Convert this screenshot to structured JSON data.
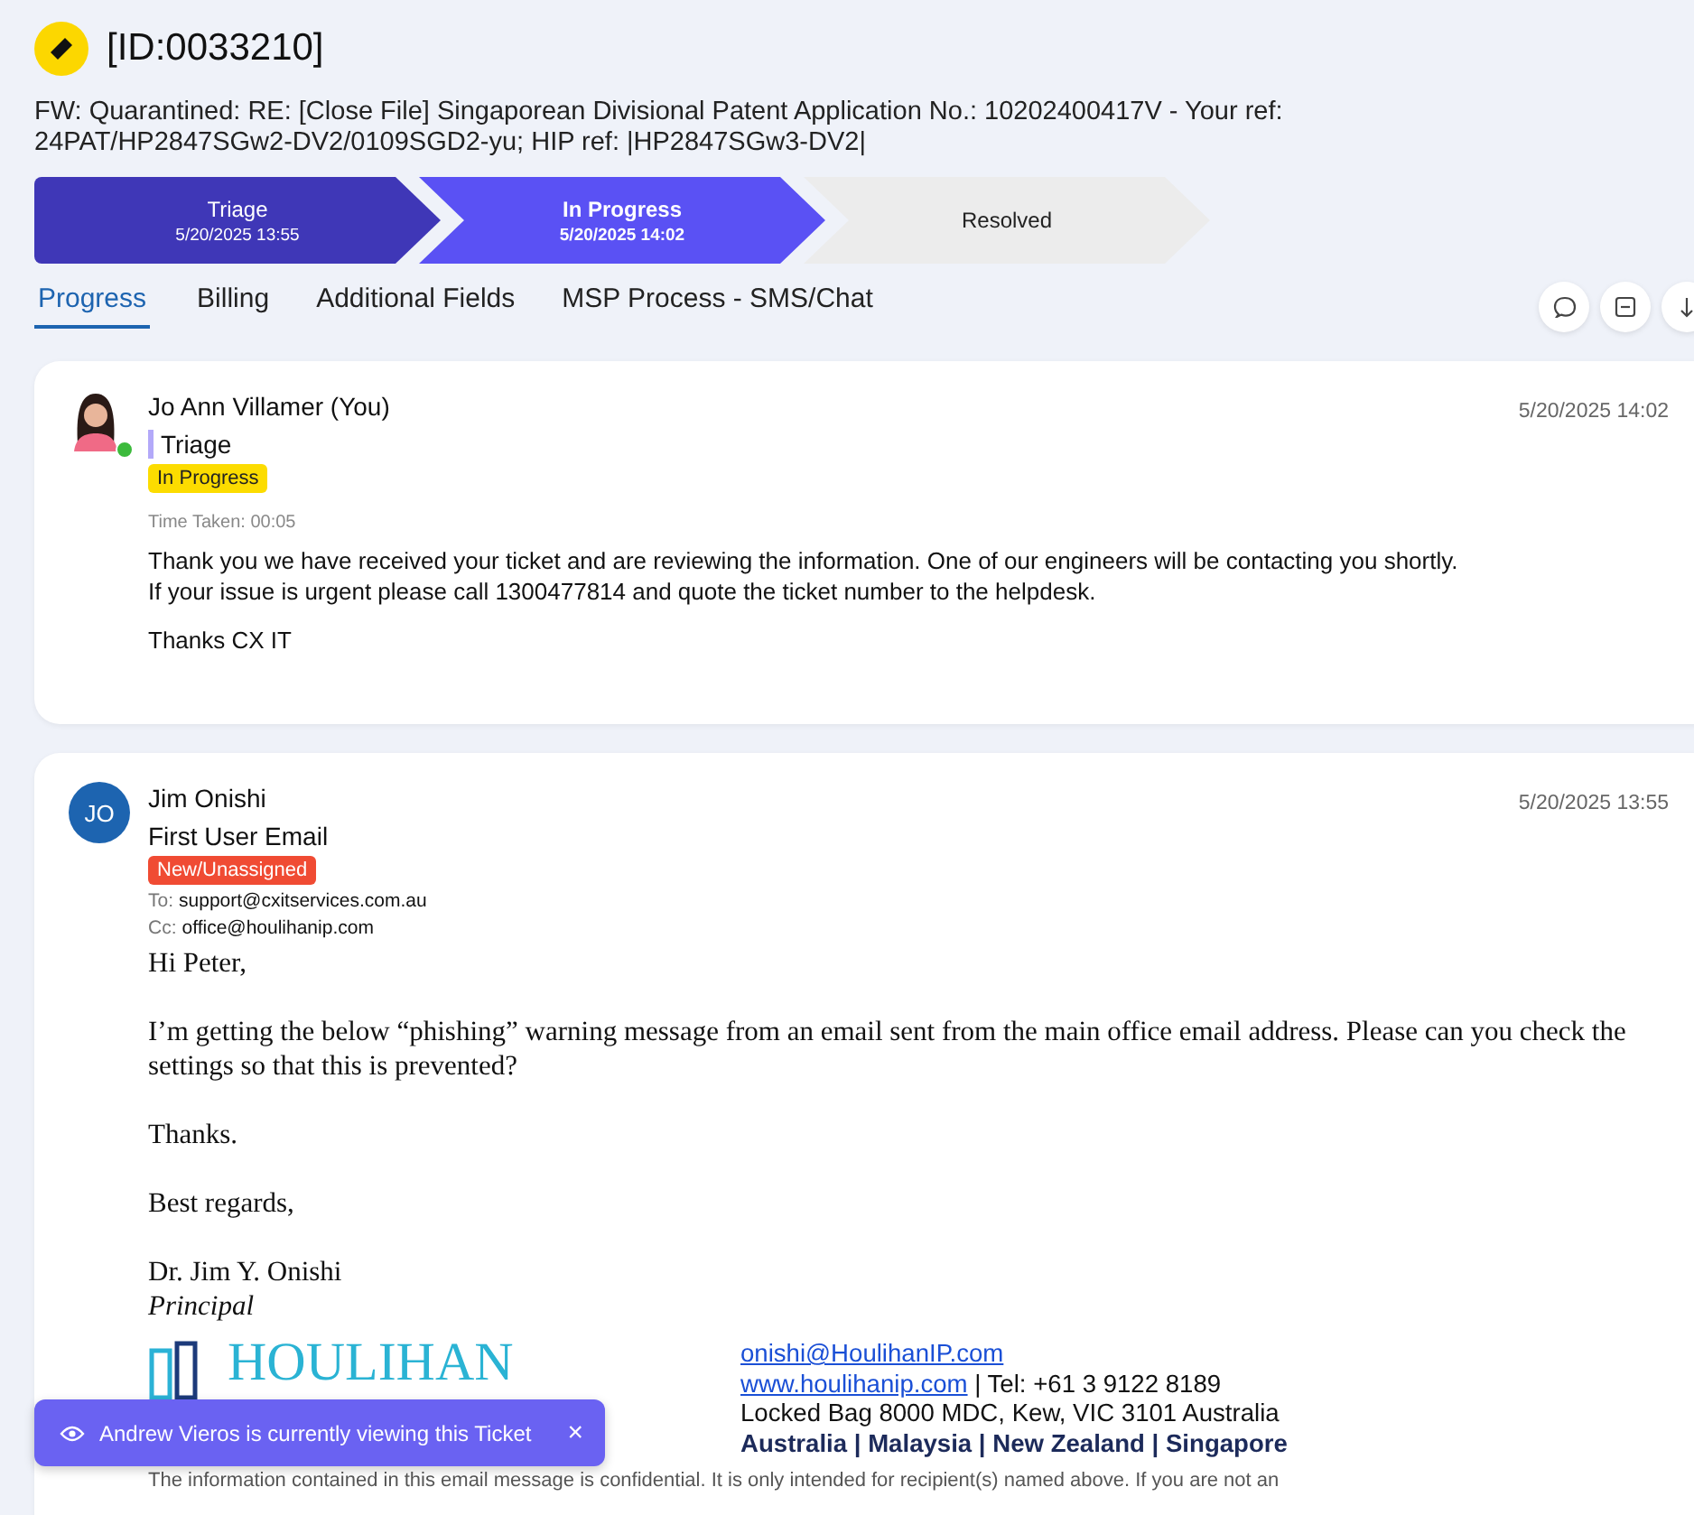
{
  "ticket": {
    "id": "[ID:0033210]",
    "subject": "FW: Quarantined: RE: [Close File] Singaporean Divisional Patent Application No.: 10202400417V - Your ref: 24PAT/HP2847SGw2-DV2/0109SGD2-yu; HIP ref: |HP2847SGw3-DV2|"
  },
  "stages": [
    {
      "label": "Triage",
      "date": "5/20/2025 13:55",
      "done": true,
      "current": false
    },
    {
      "label": "In Progress",
      "date": "5/20/2025 14:02",
      "done": false,
      "current": true
    },
    {
      "label": "Resolved",
      "done": false,
      "current": false
    }
  ],
  "tabs": [
    {
      "label": "Progress",
      "selected": true
    },
    {
      "label": "Billing",
      "selected": false
    },
    {
      "label": "Additional Fields",
      "selected": false
    },
    {
      "label": "MSP Process - SMS/Chat",
      "selected": false
    }
  ],
  "messages": [
    {
      "kind": "note",
      "author": "Jo Ann Villamer (You)",
      "avatar": {
        "kind": "picture"
      },
      "online": true,
      "stage": "Triage",
      "status": "In Progress",
      "color": "#fcdc00",
      "time_taken": "Time Taken: 00:05",
      "date": "5/20/2025 14:02",
      "body": [
        "Thank you we have received your ticket and are reviewing the information. One of our engineers will be contacting you shortly.\nIf your issue is urgent please call 1300477814 and quote the ticket number to the helpdesk.",
        "Thanks CX IT"
      ]
    },
    {
      "kind": "email",
      "author": "Jim Onishi",
      "avatar": {
        "kind": "initials",
        "initials": "JO"
      },
      "online": false,
      "stage": "First User Email",
      "status": "New/Unassigned",
      "color": "#f04b33",
      "date": "5/20/2025 13:55",
      "to_label": "To:",
      "to": "support@cxitservices.com.au",
      "cc_label": "Cc:",
      "cc": "office@houlihanip.com",
      "body": [
        "Hi Peter,",
        "I’m getting the below “phishing” warning message from an email sent from the main office email address. Please can you check the settings so that this is prevented?",
        "Thanks.",
        "Best regards,"
      ],
      "signature": {
        "name": "Dr. Jim Y. Onishi",
        "title": "Principal",
        "logo": "HOULIHAN",
        "email": "onishi@HoulihanIP.com",
        "website": "www.houlihanip.com",
        "phone": " | Tel: +61 3 9122 8189",
        "address": "Locked Bag 8000 MDC, Kew, VIC 3101 Australia",
        "regions": "Australia | Malaysia | New Zealand | Singapore",
        "disclaimer": "The information contained in this email message is confidential. It is only intended for recipient(s) named above. If you are not an"
      }
    }
  ],
  "toast": {
    "text": "Andrew Vieros is currently viewing this Ticket",
    "close": "×"
  }
}
